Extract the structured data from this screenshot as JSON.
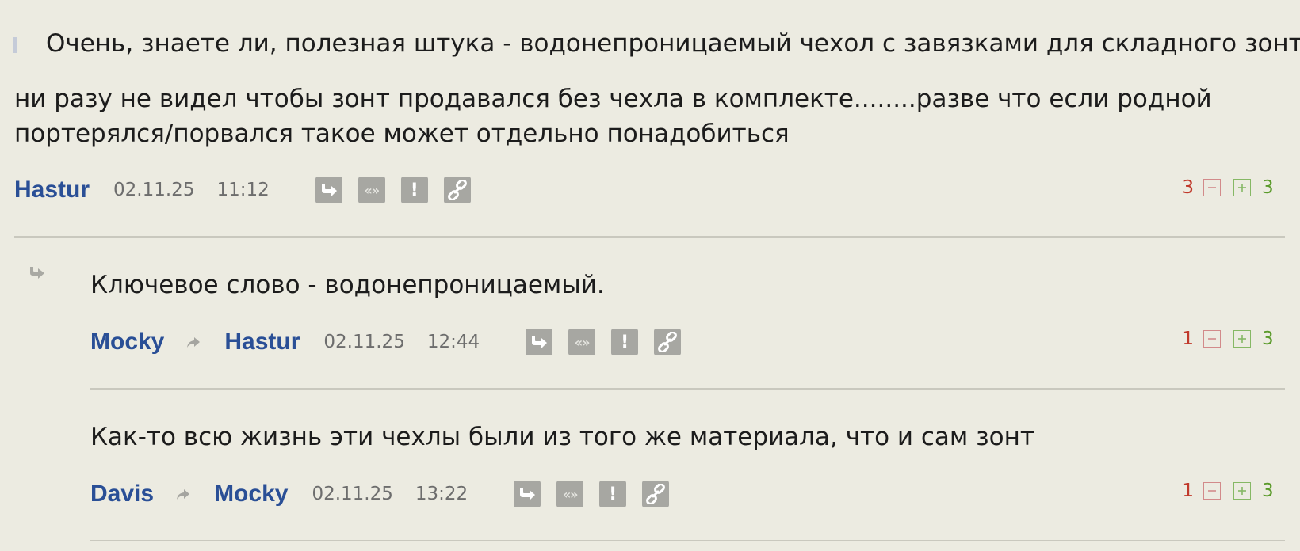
{
  "comments": [
    {
      "quote": "Очень, знаете ли, полезная штука - водонепроницаемый чехол с завязками для складного зонта.",
      "text_line1": "ни разу не видел чтобы зонт продавался без чехла в комплекте........разве что если родной",
      "text_line2": "портерялся/порвался такое может отдельно понадобиться",
      "author": "Hastur",
      "date": "02.11.25",
      "time": "11:12",
      "rating_minus": "3",
      "rating_plus": "3"
    },
    {
      "text": "Ключевое слово - водонепроницаемый.",
      "author": "Mocky",
      "reply_to": "Hastur",
      "date": "02.11.25",
      "time": "12:44",
      "rating_minus": "1",
      "rating_plus": "3"
    },
    {
      "text": "Как-то всю жизнь эти чехлы были из того же материала, что и сам зонт",
      "author": "Davis",
      "reply_to": "Mocky",
      "date": "02.11.25",
      "time": "13:22",
      "rating_minus": "1",
      "rating_plus": "3"
    }
  ],
  "actions": {
    "reply_icon": "reply-arrow-icon",
    "quote_label": "«»",
    "report_label": "!",
    "link_icon": "chain-link-icon"
  },
  "colors": {
    "background": "#ecebe1",
    "author": "#2a4f96",
    "minus": "#c0392b",
    "plus": "#5a9a2a",
    "button": "#a7a7a2"
  }
}
